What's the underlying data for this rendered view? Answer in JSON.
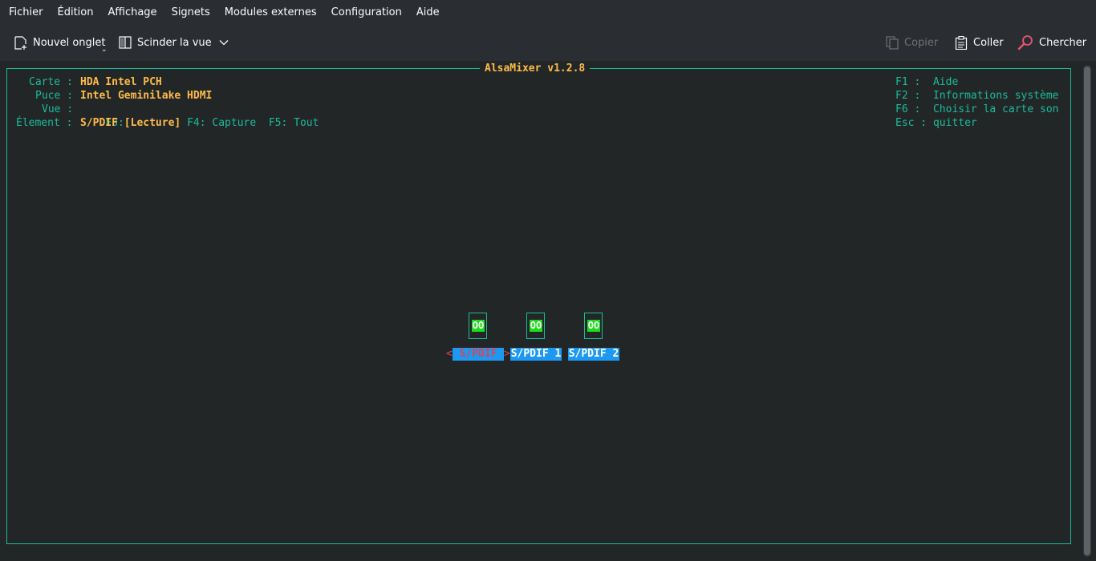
{
  "menubar": {
    "items": [
      "Fichier",
      "Édition",
      "Affichage",
      "Signets",
      "Modules externes",
      "Configuration",
      "Aide"
    ]
  },
  "toolbar": {
    "new_tab": "Nouvel onglet",
    "split_view": "Scinder la vue",
    "copy": "Copier",
    "paste": "Coller",
    "find": "Chercher"
  },
  "mixer": {
    "title": "AlsaMixer v1.2.8",
    "card_label": "Carte :",
    "card_value": "HDA Intel PCH",
    "chip_label": "Puce :",
    "chip_value": "Intel Geminilake HDMI",
    "view_label": "Vue :",
    "view_f3_key": "F3:",
    "view_f3_active": "[Lecture]",
    "view_rest": "F4: Capture  F5: Tout",
    "element_label": "Élement :",
    "element_value": "S/PDIF",
    "help": [
      "F1 :  Aide",
      "F2 :  Informations système",
      "F6 :  Choisir la carte son",
      "Esc : quitter"
    ],
    "controls": [
      {
        "name": "S/PDIF",
        "value": "OO",
        "selected": true
      },
      {
        "name": "S/PDIF 1",
        "value": "OO",
        "selected": false
      },
      {
        "name": "S/PDIF 2",
        "value": "OO",
        "selected": false
      }
    ],
    "selection_left": "<",
    "selection_right": ">"
  },
  "colors": {
    "frame": "#1abc9c",
    "value_text": "#fdbc4b",
    "control_name_bg": "#1d99f3",
    "switch_on": "#1cdc1c",
    "selected_text": "#da4453"
  }
}
